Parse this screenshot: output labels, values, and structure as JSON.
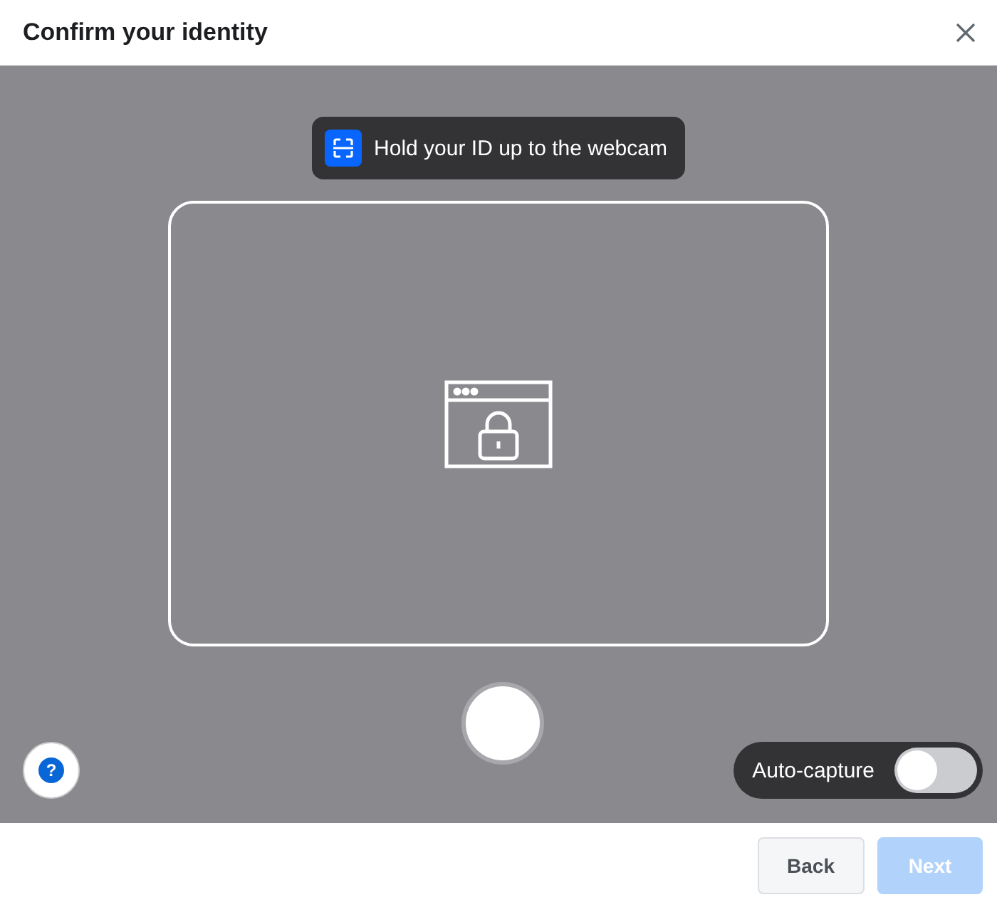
{
  "window": {
    "title": "Confirm your identity"
  },
  "instruction": {
    "text": "Hold your ID up to the webcam"
  },
  "help": {
    "label": "?"
  },
  "auto_capture": {
    "label": "Auto-capture",
    "on": false
  },
  "buttons": [
    {
      "label": "Back",
      "disabled": false,
      "kind": "secondary"
    },
    {
      "label": "Next",
      "disabled": true,
      "kind": "primary"
    }
  ]
}
